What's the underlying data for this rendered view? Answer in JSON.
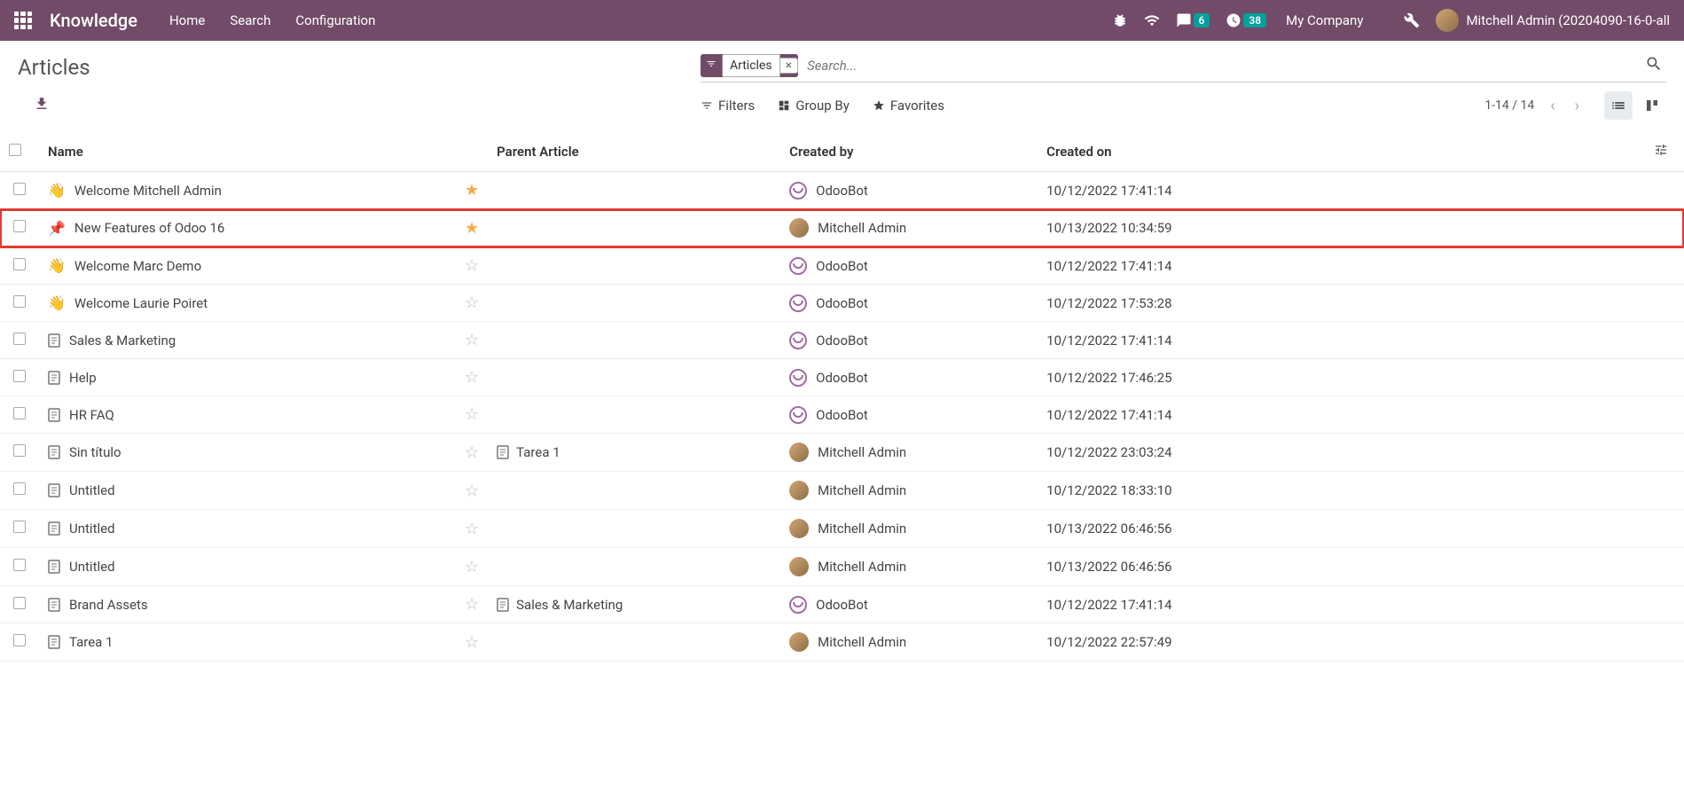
{
  "navbar": {
    "brand": "Knowledge",
    "links": [
      "Home",
      "Search",
      "Configuration"
    ],
    "chat_badge": "6",
    "clock_badge": "38",
    "company": "My Company",
    "user": "Mitchell Admin (20204090-16-0-all"
  },
  "control_panel": {
    "title": "Articles",
    "facet_label": "Articles",
    "search_placeholder": "Search...",
    "filters_label": "Filters",
    "groupby_label": "Group By",
    "favorites_label": "Favorites",
    "pager": "1-14 / 14"
  },
  "columns": {
    "name": "Name",
    "parent": "Parent Article",
    "created_by": "Created by",
    "created_on": "Created on"
  },
  "rows": [
    {
      "emoji": "👋",
      "name": "Welcome Mitchell Admin",
      "starred": true,
      "parent": "",
      "user": "OdooBot",
      "user_type": "bot",
      "date": "10/12/2022 17:41:14",
      "highlighted": false
    },
    {
      "emoji": "📌",
      "name": "New Features of Odoo 16",
      "starred": true,
      "parent": "",
      "user": "Mitchell Admin",
      "user_type": "human",
      "date": "10/13/2022 10:34:59",
      "highlighted": true
    },
    {
      "emoji": "👋",
      "name": "Welcome Marc Demo",
      "starred": false,
      "parent": "",
      "user": "OdooBot",
      "user_type": "bot",
      "date": "10/12/2022 17:41:14",
      "highlighted": false
    },
    {
      "emoji": "👋",
      "name": "Welcome Laurie Poiret",
      "starred": false,
      "parent": "",
      "user": "OdooBot",
      "user_type": "bot",
      "date": "10/12/2022 17:53:28",
      "highlighted": false
    },
    {
      "emoji": "doc",
      "name": "Sales & Marketing",
      "starred": false,
      "parent": "",
      "user": "OdooBot",
      "user_type": "bot",
      "date": "10/12/2022 17:41:14",
      "highlighted": false
    },
    {
      "emoji": "doc",
      "name": "Help",
      "starred": false,
      "parent": "",
      "user": "OdooBot",
      "user_type": "bot",
      "date": "10/12/2022 17:46:25",
      "highlighted": false
    },
    {
      "emoji": "doc",
      "name": "HR FAQ",
      "starred": false,
      "parent": "",
      "user": "OdooBot",
      "user_type": "bot",
      "date": "10/12/2022 17:41:14",
      "highlighted": false
    },
    {
      "emoji": "doc",
      "name": "Sin título",
      "starred": false,
      "parent": "Tarea 1",
      "parent_icon": "doc",
      "user": "Mitchell Admin",
      "user_type": "human",
      "date": "10/12/2022 23:03:24",
      "highlighted": false
    },
    {
      "emoji": "doc",
      "name": "Untitled",
      "starred": false,
      "parent": "",
      "user": "Mitchell Admin",
      "user_type": "human",
      "date": "10/12/2022 18:33:10",
      "highlighted": false
    },
    {
      "emoji": "doc",
      "name": "Untitled",
      "starred": false,
      "parent": "",
      "user": "Mitchell Admin",
      "user_type": "human",
      "date": "10/13/2022 06:46:56",
      "highlighted": false
    },
    {
      "emoji": "doc",
      "name": "Untitled",
      "starred": false,
      "parent": "",
      "user": "Mitchell Admin",
      "user_type": "human",
      "date": "10/13/2022 06:46:56",
      "highlighted": false
    },
    {
      "emoji": "doc",
      "name": "Brand Assets",
      "starred": false,
      "parent": "Sales & Marketing",
      "parent_icon": "doc",
      "user": "OdooBot",
      "user_type": "bot",
      "date": "10/12/2022 17:41:14",
      "highlighted": false
    },
    {
      "emoji": "doc",
      "name": "Tarea 1",
      "starred": false,
      "parent": "",
      "user": "Mitchell Admin",
      "user_type": "human",
      "date": "10/12/2022 22:57:49",
      "highlighted": false
    }
  ]
}
